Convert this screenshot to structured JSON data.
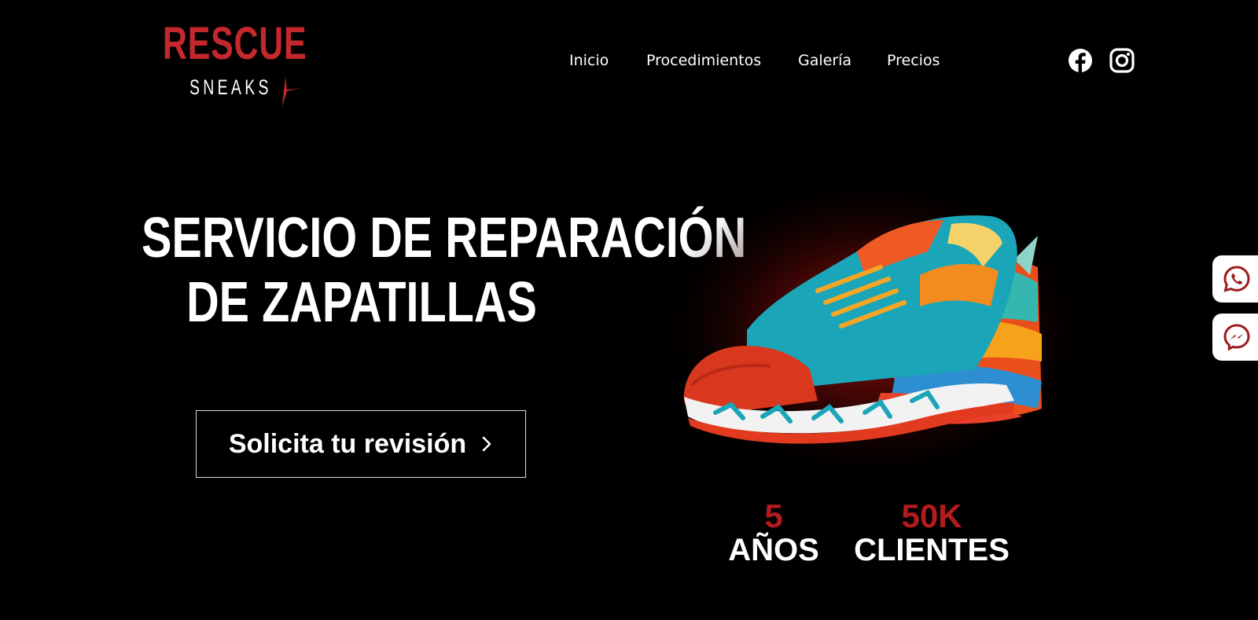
{
  "brand": {
    "logo_top": "RESCUE",
    "logo_bottom": "SNEAKS"
  },
  "nav": {
    "items": [
      {
        "label": "Inicio"
      },
      {
        "label": "Procedimientos"
      },
      {
        "label": "Galería"
      },
      {
        "label": "Precios"
      }
    ]
  },
  "social": {
    "icons": [
      "facebook-icon",
      "instagram-icon"
    ]
  },
  "hero": {
    "title_line1": "SERVICIO DE REPARACIÓN",
    "title_line2": "DE ZAPATILLAS",
    "cta_label": "Solicita tu revisión"
  },
  "stats": [
    {
      "value": "5",
      "label": "AÑOS"
    },
    {
      "value": "50K",
      "label": "CLIENTES"
    }
  ],
  "floating": {
    "icons": [
      "whatsapp-icon",
      "messenger-icon"
    ]
  },
  "colors": {
    "background": "#000000",
    "accent_red": "#c4282d",
    "stat_red": "#b31b1f",
    "text": "#ffffff"
  }
}
